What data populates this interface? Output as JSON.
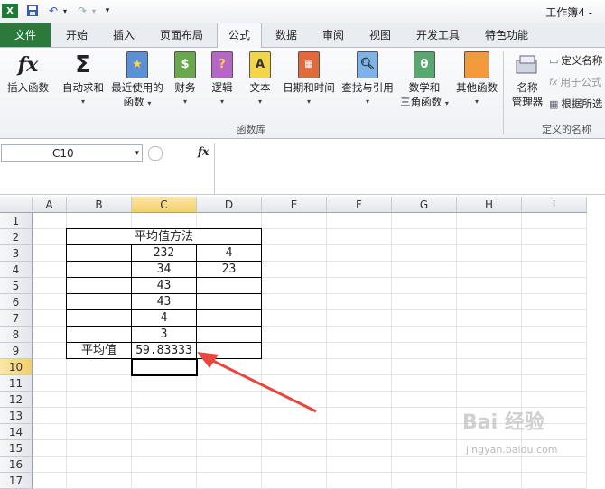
{
  "window": {
    "title": "工作簿4 - "
  },
  "tabs": [
    {
      "label": "文件"
    },
    {
      "label": "开始"
    },
    {
      "label": "插入"
    },
    {
      "label": "页面布局"
    },
    {
      "label": "公式"
    },
    {
      "label": "数据"
    },
    {
      "label": "审阅"
    },
    {
      "label": "视图"
    },
    {
      "label": "开发工具"
    },
    {
      "label": "特色功能"
    }
  ],
  "ribbon": {
    "buttons": [
      {
        "label": "插入函数",
        "label2": ""
      },
      {
        "label": "自动求和",
        "label2": ""
      },
      {
        "label": "最近使用的",
        "label2": "函数"
      },
      {
        "label": "财务",
        "label2": ""
      },
      {
        "label": "逻辑",
        "label2": ""
      },
      {
        "label": "文本",
        "label2": ""
      },
      {
        "label": "日期和时间",
        "label2": ""
      },
      {
        "label": "查找与引用",
        "label2": ""
      },
      {
        "label": "数学和",
        "label2": "三角函数"
      },
      {
        "label": "其他函数",
        "label2": ""
      },
      {
        "label": "名称",
        "label2": "管理器"
      }
    ],
    "group_label": "函数库",
    "group_label2": "定义的名称",
    "name_cmds": [
      "定义名称",
      "用于公式",
      "根据所选"
    ]
  },
  "formula_bar": {
    "name_box": "C10",
    "fx": "fx",
    "formula": ""
  },
  "columns": [
    "A",
    "B",
    "C",
    "D",
    "E",
    "F",
    "G",
    "H",
    "I"
  ],
  "rows": [
    "1",
    "2",
    "3",
    "4",
    "5",
    "6",
    "7",
    "8",
    "9",
    "10",
    "11",
    "12",
    "13",
    "14",
    "15",
    "16",
    "17"
  ],
  "cells": {
    "B2": "平均值方法",
    "C3": "232",
    "D3": "4",
    "C4": "34",
    "D4": "23",
    "C5": "43",
    "C6": "43",
    "C7": "4",
    "C8": "3",
    "B9": "平均值",
    "C9": "59.83333"
  },
  "selected_cell": "C10",
  "watermark": {
    "text": "Bai 经验",
    "url": "jingyan.baidu.com"
  },
  "colors": {
    "accent": "#2b7a3b",
    "selection": "#f3cf6a",
    "arrow": "#e8473f"
  }
}
